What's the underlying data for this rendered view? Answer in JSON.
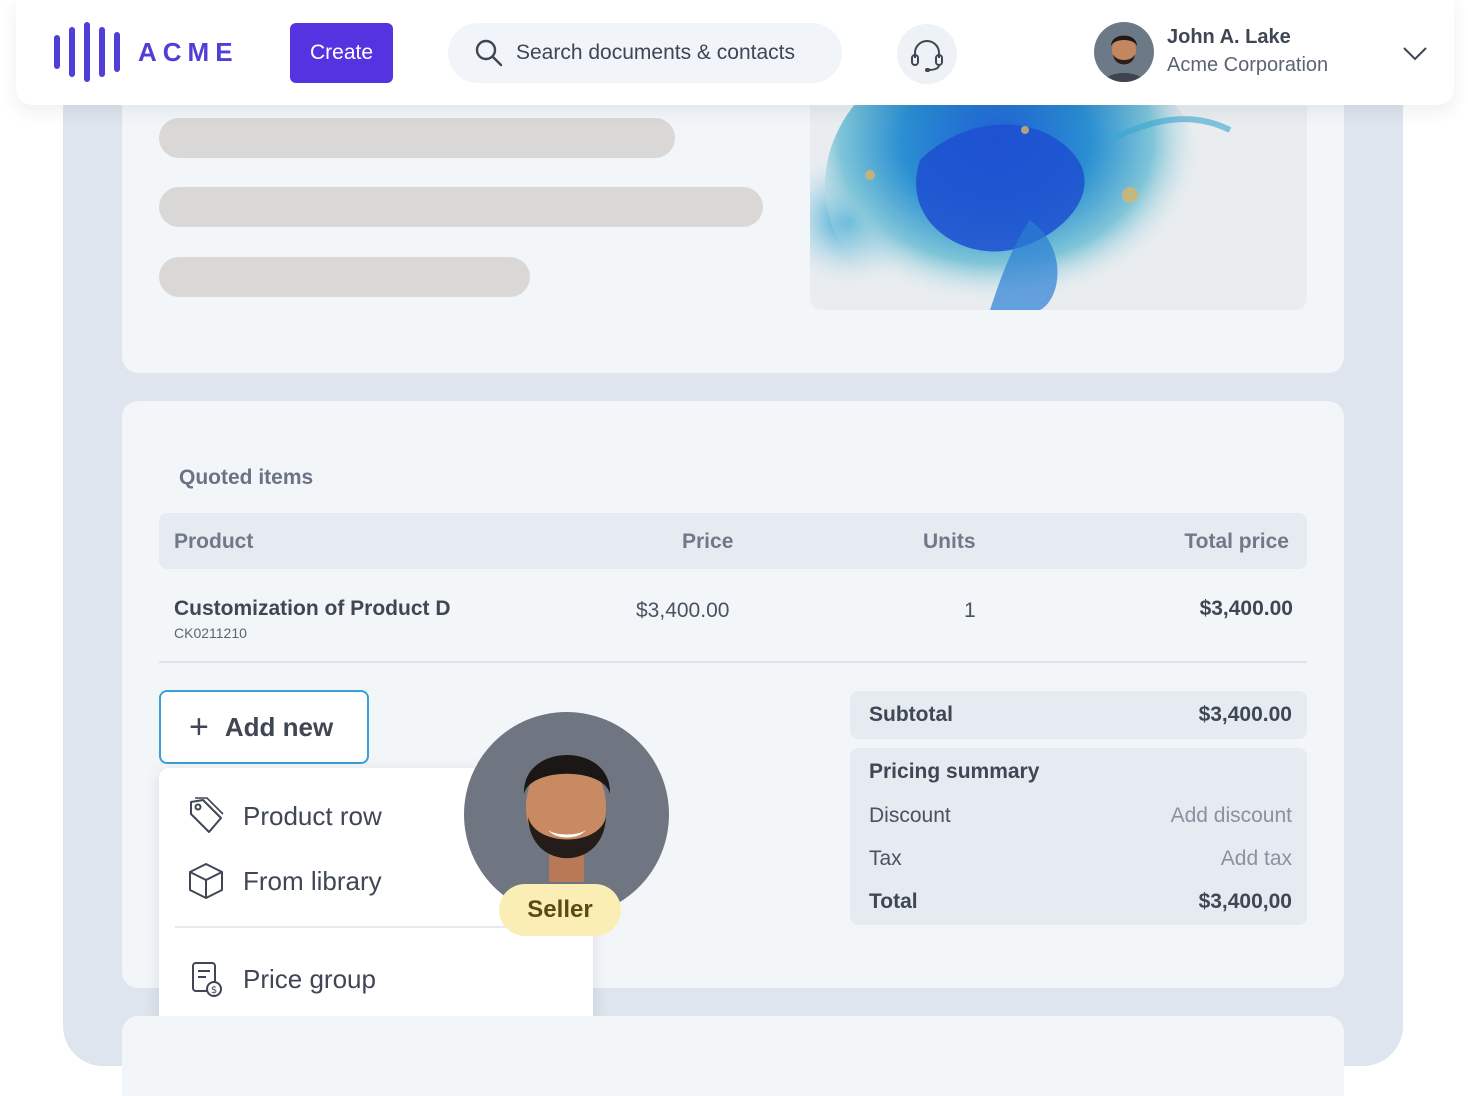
{
  "brand": {
    "name": "ACME",
    "accent": "#5533e0"
  },
  "header": {
    "create_label": "Create",
    "search_placeholder": "Search documents & contacts",
    "user": {
      "name": "John A. Lake",
      "company": "Acme Corporation"
    }
  },
  "quote": {
    "section_title": "Quoted items",
    "columns": [
      "Product",
      "Price",
      "Units",
      "Total price"
    ],
    "rows": [
      {
        "product": "Customization of Product D",
        "code": "CK0211210",
        "price": "$3,400.00",
        "units": "1",
        "total": "$3,400.00"
      }
    ]
  },
  "add_menu": {
    "button_label": "Add new",
    "items": [
      "Product row",
      "From library",
      "Price group"
    ]
  },
  "seller": {
    "badge": "Seller"
  },
  "summary": {
    "subtotal_label": "Subtotal",
    "subtotal_value": "$3,400.00",
    "title": "Pricing summary",
    "discount_label": "Discount",
    "discount_action": "Add discount",
    "tax_label": "Tax",
    "tax_action": "Add tax",
    "total_label": "Total",
    "total_value": "$3,400,00"
  }
}
